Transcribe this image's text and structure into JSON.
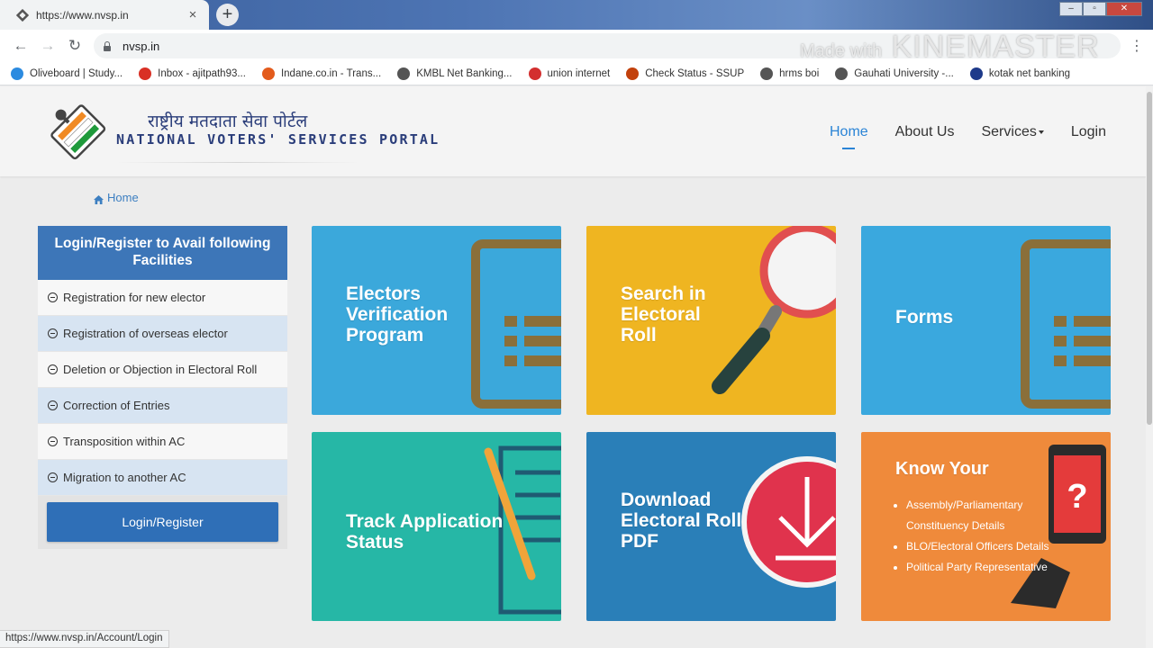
{
  "browser": {
    "tab_title": "https://www.nvsp.in",
    "tab_close": "×",
    "new_tab": "+",
    "url": "nvsp.in",
    "watermark_prefix": "Made with",
    "watermark_brand": "KINEMASTER",
    "bookmarks": [
      {
        "label": "Oliveboard | Study...",
        "icon": "oliveboard-icon",
        "color": "#2c8be0"
      },
      {
        "label": "Inbox - ajitpath93...",
        "icon": "gmail-icon",
        "color": "#d93025"
      },
      {
        "label": "Indane.co.in - Trans...",
        "icon": "indane-icon",
        "color": "#e35b1c"
      },
      {
        "label": "KMBL Net Banking...",
        "icon": "globe-icon",
        "color": "#555555"
      },
      {
        "label": "union internet",
        "icon": "union-bank-icon",
        "color": "#d32f2f"
      },
      {
        "label": "Check Status - SSUP",
        "icon": "ssup-icon",
        "color": "#c2410c"
      },
      {
        "label": "hrms boi",
        "icon": "globe-icon",
        "color": "#555555"
      },
      {
        "label": "Gauhati University -...",
        "icon": "globe-icon",
        "color": "#555555"
      },
      {
        "label": "kotak net banking",
        "icon": "kotak-icon",
        "color": "#1e3a8a"
      }
    ],
    "status_url": "https://www.nvsp.in/Account/Login"
  },
  "header": {
    "title_hindi": "राष्ट्रीय मतदाता सेवा पोर्टल",
    "title_english": "NATIONAL VOTERS' SERVICES PORTAL",
    "nav": [
      {
        "label": "Home",
        "active": true
      },
      {
        "label": "About Us",
        "active": false
      },
      {
        "label": "Services",
        "active": false,
        "dropdown": true
      },
      {
        "label": "Login",
        "active": false
      }
    ]
  },
  "breadcrumb": {
    "label": "Home"
  },
  "sidebar": {
    "heading": "Login/Register to Avail following Facilities",
    "items": [
      "Registration for new elector",
      "Registration of overseas elector",
      "Deletion or Objection in Electoral Roll",
      "Correction of Entries",
      "Transposition within AC",
      "Migration to another AC"
    ],
    "button": "Login/Register"
  },
  "cards": [
    {
      "label": "Electors Verification Program",
      "color": "#3ba8db"
    },
    {
      "label": "Search in Electoral Roll",
      "color": "#efb521"
    },
    {
      "label": "Forms",
      "color": "#3aa8de"
    },
    {
      "label": "Track Application Status",
      "color": "#26b7a6"
    },
    {
      "label": "Download Electoral Roll PDF",
      "color": "#2a7fb8"
    },
    {
      "label": "Know Your",
      "color": "#ef8a3b",
      "items": [
        "Assembly/Parliamentary Constituency Details",
        "BLO/Electoral Officers Details",
        "Political Party Representative"
      ]
    }
  ]
}
